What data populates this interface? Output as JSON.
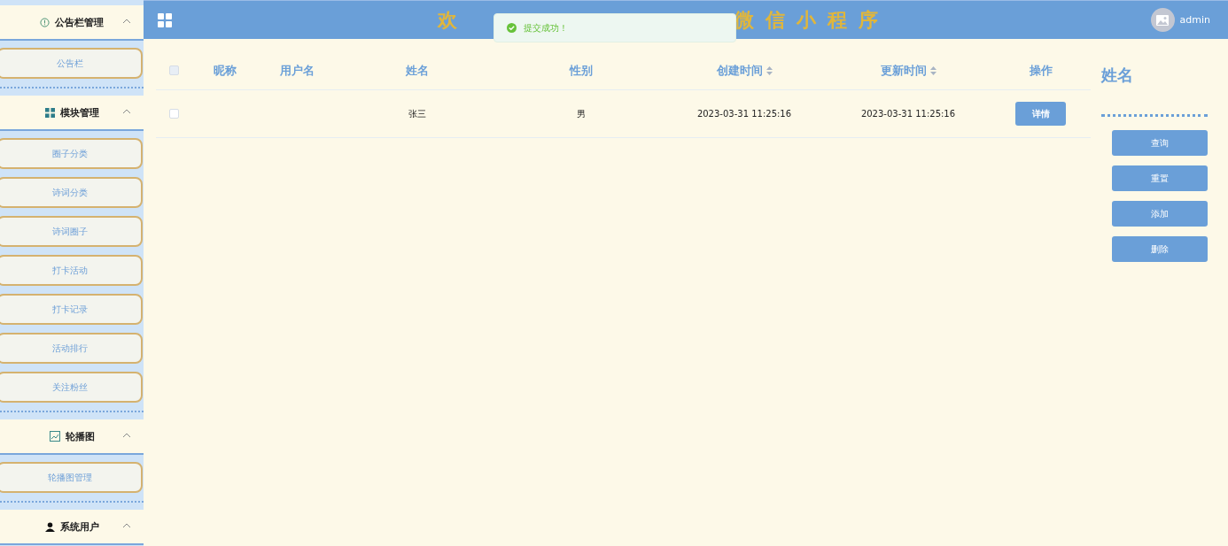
{
  "header": {
    "title_parts": [
      "欢",
      "微信小程序"
    ],
    "user": "admin"
  },
  "toast": {
    "message": "提交成功！"
  },
  "sidebar": {
    "groups": [
      {
        "title": "公告栏管理",
        "expanded": true,
        "items": [
          "公告栏"
        ]
      },
      {
        "title": "模块管理",
        "expanded": true,
        "items": [
          "圈子分类",
          "诗词分类",
          "诗词圈子",
          "打卡活动",
          "打卡记录",
          "活动排行",
          "关注粉丝"
        ]
      },
      {
        "title": "轮播图",
        "expanded": true,
        "items": [
          "轮播图管理"
        ]
      },
      {
        "title": "系统用户",
        "expanded": true
      }
    ]
  },
  "table": {
    "select_all": {
      "checked": false
    },
    "columns": [
      {
        "label": "昵称",
        "sortable": false
      },
      {
        "label": "用户名",
        "sortable": false
      },
      {
        "label": "姓名",
        "sortable": false
      },
      {
        "label": "性别",
        "sortable": false
      },
      {
        "label": "创建时间",
        "sortable": true
      },
      {
        "label": "更新时间",
        "sortable": true
      },
      {
        "label": "操作",
        "sortable": false
      }
    ],
    "rows": [
      {
        "checked": false,
        "name": "张三",
        "gender": "男",
        "created": "2023-03-31 11:25:16",
        "updated": "2023-03-31 11:25:16",
        "action": "详情"
      }
    ]
  },
  "search_panel": {
    "label": "姓名",
    "buttons": [
      "查询",
      "重置",
      "添加",
      "删除"
    ]
  }
}
